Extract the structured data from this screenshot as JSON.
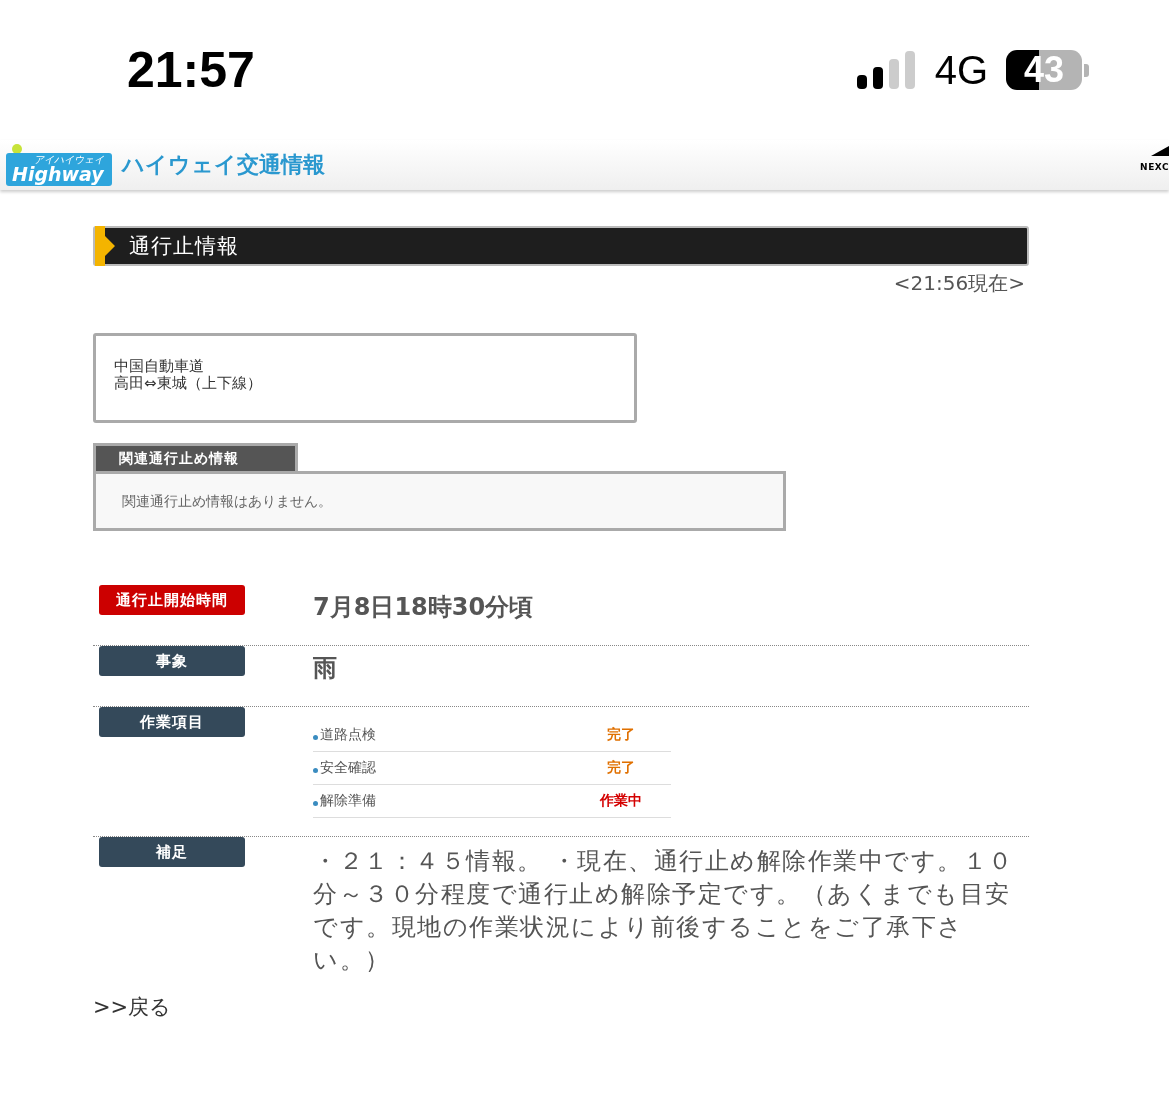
{
  "status_bar": {
    "time": "21:57",
    "network": "4G",
    "battery": "43"
  },
  "header": {
    "logo_text": "Highway",
    "logo_ruby": "アイハイウェイ",
    "site_title": "ハイウェイ交通情報",
    "partner_logo": "NEXC"
  },
  "page_title": "通行止情報",
  "timestamp": "<21:56現在>",
  "route": {
    "road": "中国自動車道",
    "section": "高田⇔東城（上下線）"
  },
  "related": {
    "tab": "関連通行止め情報",
    "message": "関連通行止め情報はありません。"
  },
  "details": [
    {
      "kind": "text",
      "label": "通行止開始時間",
      "color": "#cc0000",
      "value": "7月8日18時30分頃"
    },
    {
      "kind": "text",
      "label": "事象",
      "color": "#34495a",
      "value": "雨"
    },
    {
      "kind": "tasks",
      "label": "作業項目",
      "color": "#34495a",
      "tasks": [
        {
          "name": "道路点検",
          "status": "完了",
          "color": "#e07000"
        },
        {
          "name": "安全確認",
          "status": "完了",
          "color": "#e07000"
        },
        {
          "name": "解除準備",
          "status": "作業中",
          "color": "#d40000"
        }
      ]
    },
    {
      "kind": "note",
      "label": "補足",
      "color": "#34495a",
      "value": "・２１：４５情報。 ・現在、通行止め解除作業中です。１０分～３０分程度で通行止め解除予定です。（あくまでも目安です。現地の作業状況により前後することをご了承下さい。）"
    }
  ],
  "back_link": ">>戻る"
}
